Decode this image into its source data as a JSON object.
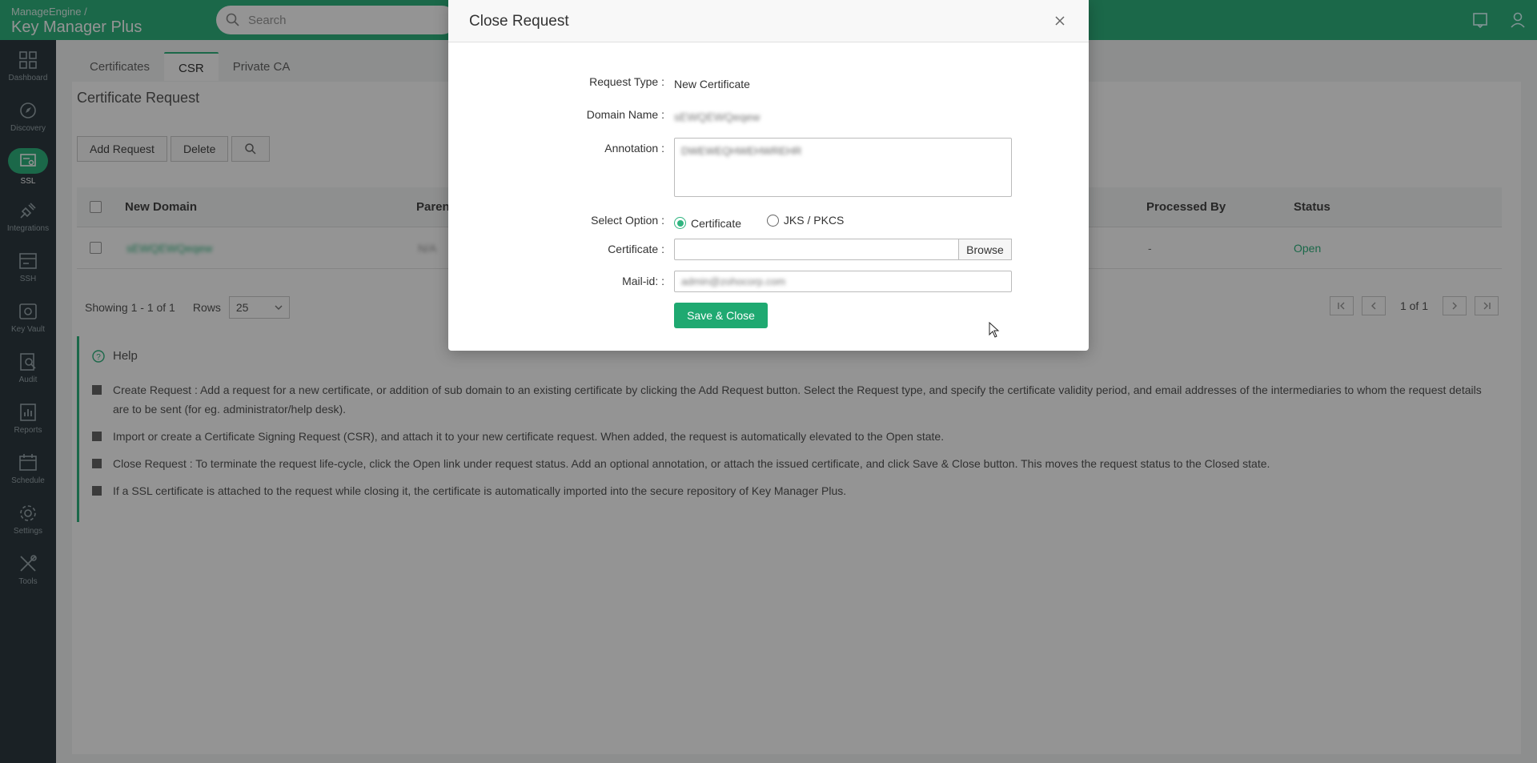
{
  "app": {
    "vendor": "ManageEngine /",
    "product": "Key Manager Plus"
  },
  "search": {
    "placeholder": "Search"
  },
  "sidebar": {
    "items": [
      {
        "label": "Dashboard",
        "icon": "dashboard-icon"
      },
      {
        "label": "Discovery",
        "icon": "compass-icon"
      },
      {
        "label": "SSL",
        "icon": "certificate-icon",
        "active": true
      },
      {
        "label": "Integrations",
        "icon": "plug-icon"
      },
      {
        "label": "SSH",
        "icon": "terminal-icon"
      },
      {
        "label": "Key Vault",
        "icon": "vault-icon"
      },
      {
        "label": "Audit",
        "icon": "audit-icon"
      },
      {
        "label": "Reports",
        "icon": "reports-icon"
      },
      {
        "label": "Schedule",
        "icon": "calendar-icon"
      },
      {
        "label": "Settings",
        "icon": "gear-icon"
      },
      {
        "label": "Tools",
        "icon": "tools-icon"
      }
    ]
  },
  "tabs": [
    "Certificates",
    "CSR",
    "Private CA"
  ],
  "page": {
    "title": "Certificate Request"
  },
  "toolbar": {
    "add": "Add Request",
    "delete": "Delete"
  },
  "table": {
    "columns": {
      "domain": "New Domain",
      "parent": "Paren",
      "processed_by": "Processed By",
      "status": "Status"
    },
    "rows": [
      {
        "domain": "sEWQEWQeqew",
        "parent": "N/A",
        "processed_by": "-",
        "status": "Open"
      }
    ]
  },
  "pager": {
    "showing": "Showing 1 - 1 of 1",
    "rows_label": "Rows",
    "rows_value": "25",
    "page_info": "1 of 1"
  },
  "help": {
    "title": "Help",
    "items": [
      "Create Request : Add a request for a new certificate, or addition of sub domain to an existing certificate by clicking the Add Request button. Select the Request type, and specify the certificate validity period, and email addresses of the intermediaries to whom the request details are to be sent (for eg. administrator/help desk).",
      "Import or create a Certificate Signing Request (CSR), and attach it to your new certificate request. When added, the request is automatically elevated to the Open state.",
      "Close Request : To terminate the request life-cycle, click the Open link under request status. Add an optional annotation, or attach the issued certificate, and click Save & Close button. This moves the request status to the Closed state.",
      "If a SSL certificate is attached to the request while closing it, the certificate is automatically imported into the secure repository of Key Manager Plus."
    ]
  },
  "modal": {
    "title": "Close Request",
    "request_type_label": "Request Type",
    "request_type_value": "New Certificate",
    "domain_label": "Domain Name",
    "domain_value": "sEWQEWQeqew",
    "annotation_label": "Annotation",
    "annotation_value": "DWEWEQHWEHWREHR",
    "select_option_label": "Select Option",
    "option_certificate": "Certificate",
    "option_jks": "JKS / PKCS",
    "selected_option": "Certificate",
    "certificate_label": "Certificate",
    "browse": "Browse",
    "mail_label": "Mail-id:",
    "mail_value": "admin@zohocorp.com",
    "save": "Save & Close"
  },
  "colors": {
    "brand": "#2fb47f",
    "sidebar": "#2e3a41"
  }
}
